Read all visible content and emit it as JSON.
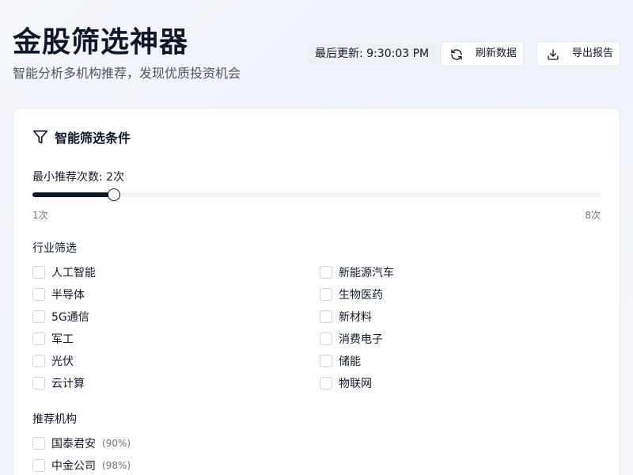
{
  "header": {
    "title": "金股筛选神器",
    "subtitle": "智能分析多机构推荐，发现优质投资机会",
    "last_update_prefix": "最后更新:",
    "last_update_time": "9:30:03 PM",
    "refresh_label": "刷新数据",
    "export_label": "导出报告"
  },
  "icons": {
    "refresh": "refresh-icon",
    "export": "download-icon",
    "filter": "filter-icon"
  },
  "filter": {
    "title": "智能筛选条件",
    "slider": {
      "label": "最小推荐次数: 2次",
      "value": 2,
      "min": 1,
      "max": 8,
      "min_label": "1次",
      "max_label": "8次"
    },
    "industry_label": "行业筛选",
    "industries": [
      "人工智能",
      "新能源汽车",
      "半导体",
      "生物医药",
      "5G通信",
      "新材料",
      "军工",
      "消费电子",
      "光伏",
      "储能",
      "云计算",
      "物联网"
    ],
    "agency_label": "推荐机构",
    "agencies": [
      {
        "name": "国泰君安",
        "pct": "(90%)"
      },
      {
        "name": "中金公司",
        "pct": "(98%)"
      }
    ]
  },
  "colors": {
    "accent": "#0f172a",
    "track": "#f1f3f7",
    "border": "#e5e7eb"
  }
}
